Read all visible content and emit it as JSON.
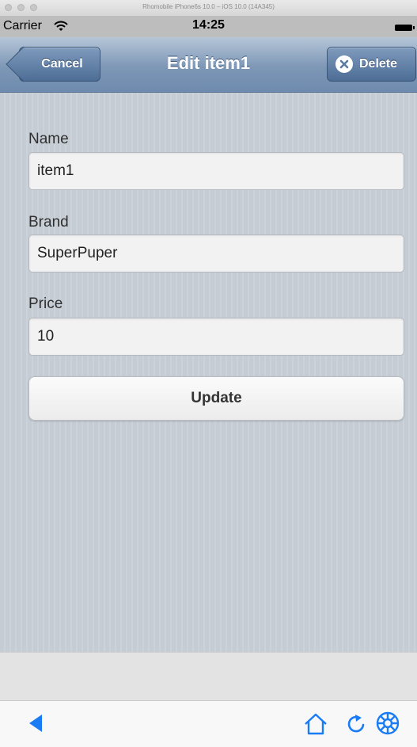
{
  "simulator": {
    "title": "Rhomobile iPhone6s 10.0 – iOS 10.0 (14A345)"
  },
  "status_bar": {
    "carrier": "Carrier",
    "time": "14:25"
  },
  "nav": {
    "title": "Edit item1",
    "cancel_label": "Cancel",
    "delete_label": "Delete"
  },
  "form": {
    "fields": [
      {
        "label": "Name",
        "value": "item1"
      },
      {
        "label": "Brand",
        "value": "SuperPuper"
      },
      {
        "label": "Price",
        "value": "10"
      }
    ],
    "submit_label": "Update"
  },
  "toolbar": {
    "icons": [
      "back-arrow-icon",
      "home-icon",
      "refresh-icon",
      "settings-icon"
    ],
    "accent_color": "#1a7cf5"
  },
  "colors": {
    "nav_bar": "#7d97b6",
    "content_bg": "#c5ccd4"
  }
}
